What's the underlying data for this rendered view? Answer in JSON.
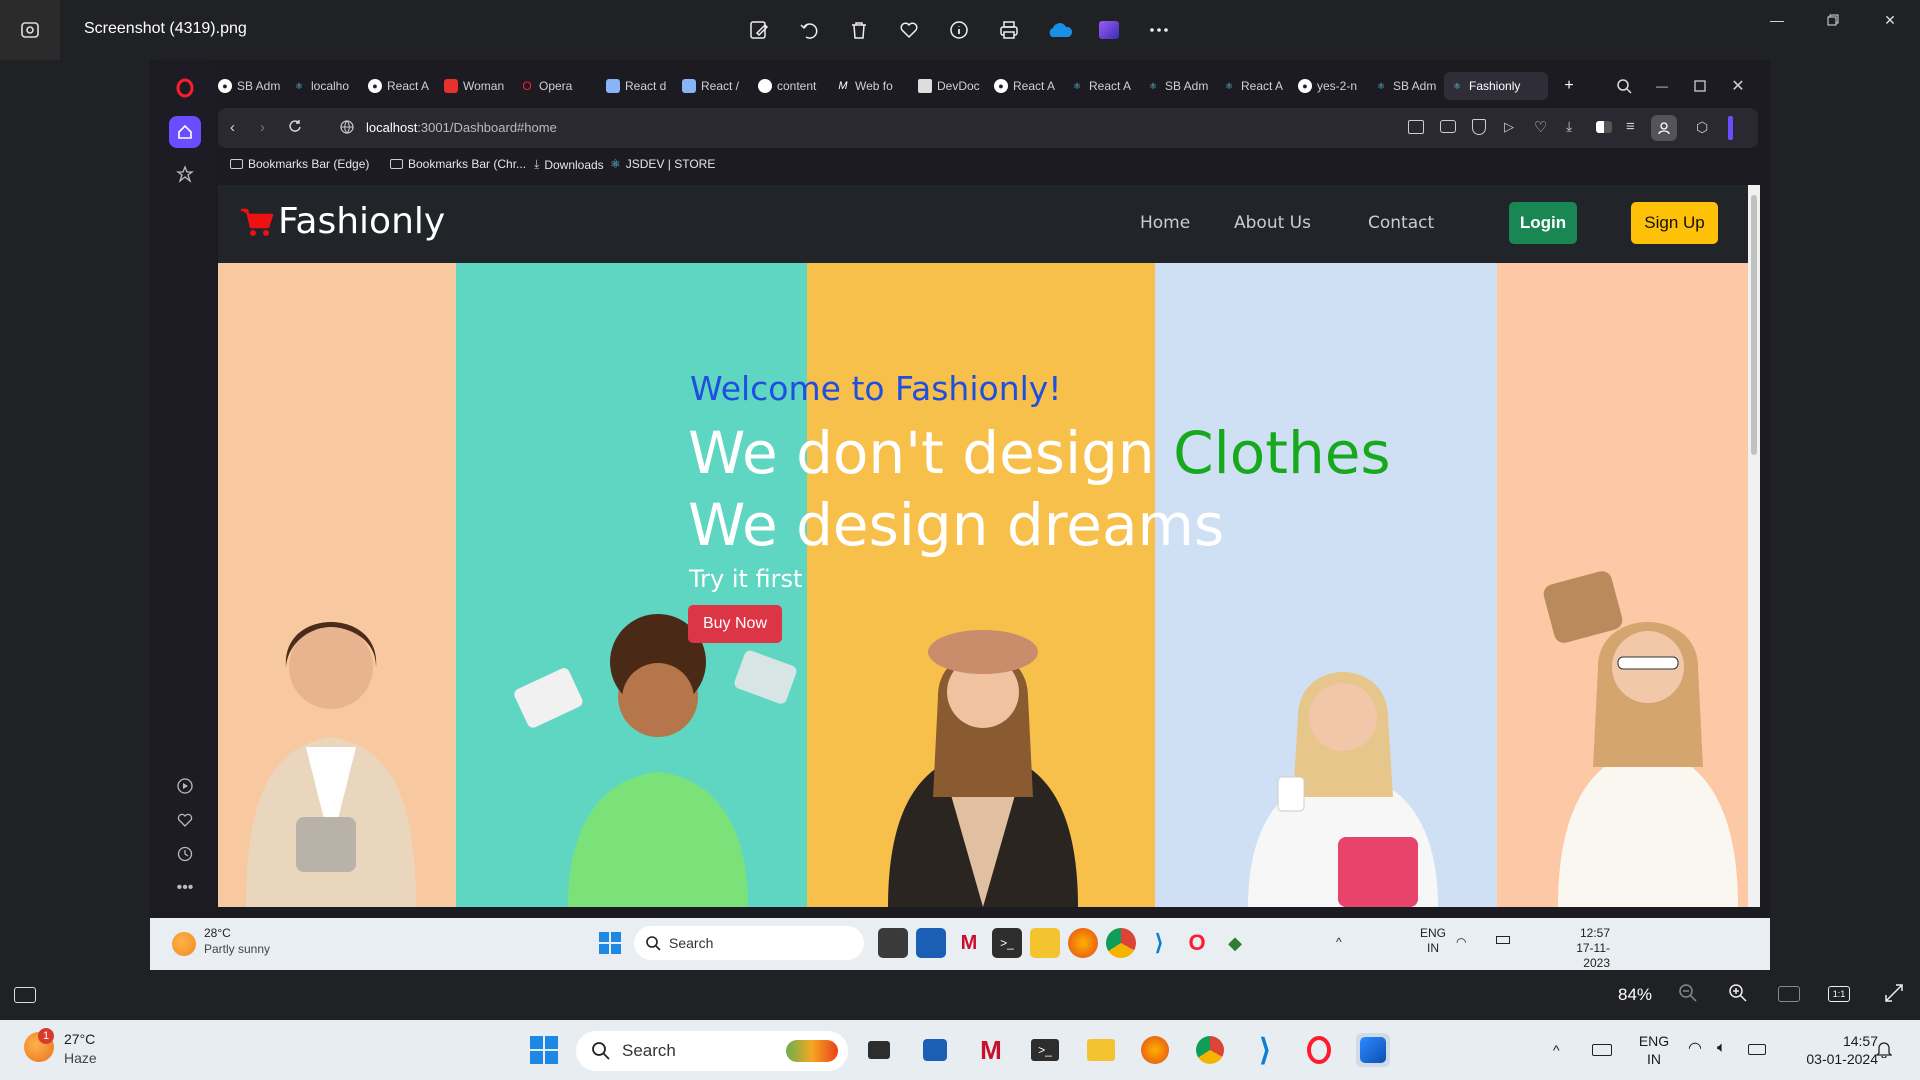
{
  "viewer": {
    "title": "Screenshot (4319).png",
    "zoom": "84%",
    "tools": [
      "edit-icon",
      "rotate-icon",
      "delete-icon",
      "favorite-icon",
      "info-icon",
      "print-icon",
      "onedrive-icon",
      "clipchamp-icon",
      "more-icon"
    ]
  },
  "browser": {
    "tabs": [
      {
        "label": "SB Adm"
      },
      {
        "label": "localho"
      },
      {
        "label": "React A"
      },
      {
        "label": "Woman"
      },
      {
        "label": "Opera"
      },
      {
        "label": "React d"
      },
      {
        "label": "React /"
      },
      {
        "label": "content"
      },
      {
        "label": "Web fo"
      },
      {
        "label": "DevDoc"
      },
      {
        "label": "React A"
      },
      {
        "label": "React A"
      },
      {
        "label": "SB Adm"
      },
      {
        "label": "React A"
      },
      {
        "label": "yes-2-n"
      },
      {
        "label": "SB Adm"
      },
      {
        "label": "Fashionly"
      }
    ],
    "url_host": "localhost",
    "url_rest": ":3001/Dashboard#home",
    "bookmarks": [
      {
        "label": "Bookmarks Bar (Edge)"
      },
      {
        "label": "Bookmarks Bar (Chr..."
      },
      {
        "label": "Downloads"
      },
      {
        "label": "JSDEV | STORE"
      }
    ]
  },
  "site": {
    "brand": "Fashionly",
    "nav": {
      "home": "Home",
      "about": "About Us",
      "contact": "Contact",
      "login": "Login",
      "signup": "Sign Up"
    },
    "hero": {
      "welcome": "Welcome to Fashionly!",
      "line1_white": "We don't design ",
      "line1_green": "Clothes",
      "line2": "We design dreams",
      "try": "Try it first",
      "buy": "Buy Now"
    },
    "colors": {
      "stripe1": "#f8c9a0",
      "stripe2": "#5fd6c2",
      "stripe3": "#f7c04a",
      "stripe4": "#cfe0f4",
      "stripe5": "#fcc8a6",
      "nav_bg": "#212529",
      "green": "#17a91d",
      "blue": "#1f4fe0"
    }
  },
  "inner_taskbar": {
    "temp": "28°C",
    "weather": "Partly sunny",
    "search": "Search",
    "lang1": "ENG",
    "lang2": "IN",
    "time": "12:57",
    "date": "17-11-2023"
  },
  "taskbar": {
    "temp": "27°C",
    "weather": "Haze",
    "weather_badge": "1",
    "search": "Search",
    "lang1": "ENG",
    "lang2": "IN",
    "time": "14:57",
    "date": "03-01-2024"
  }
}
